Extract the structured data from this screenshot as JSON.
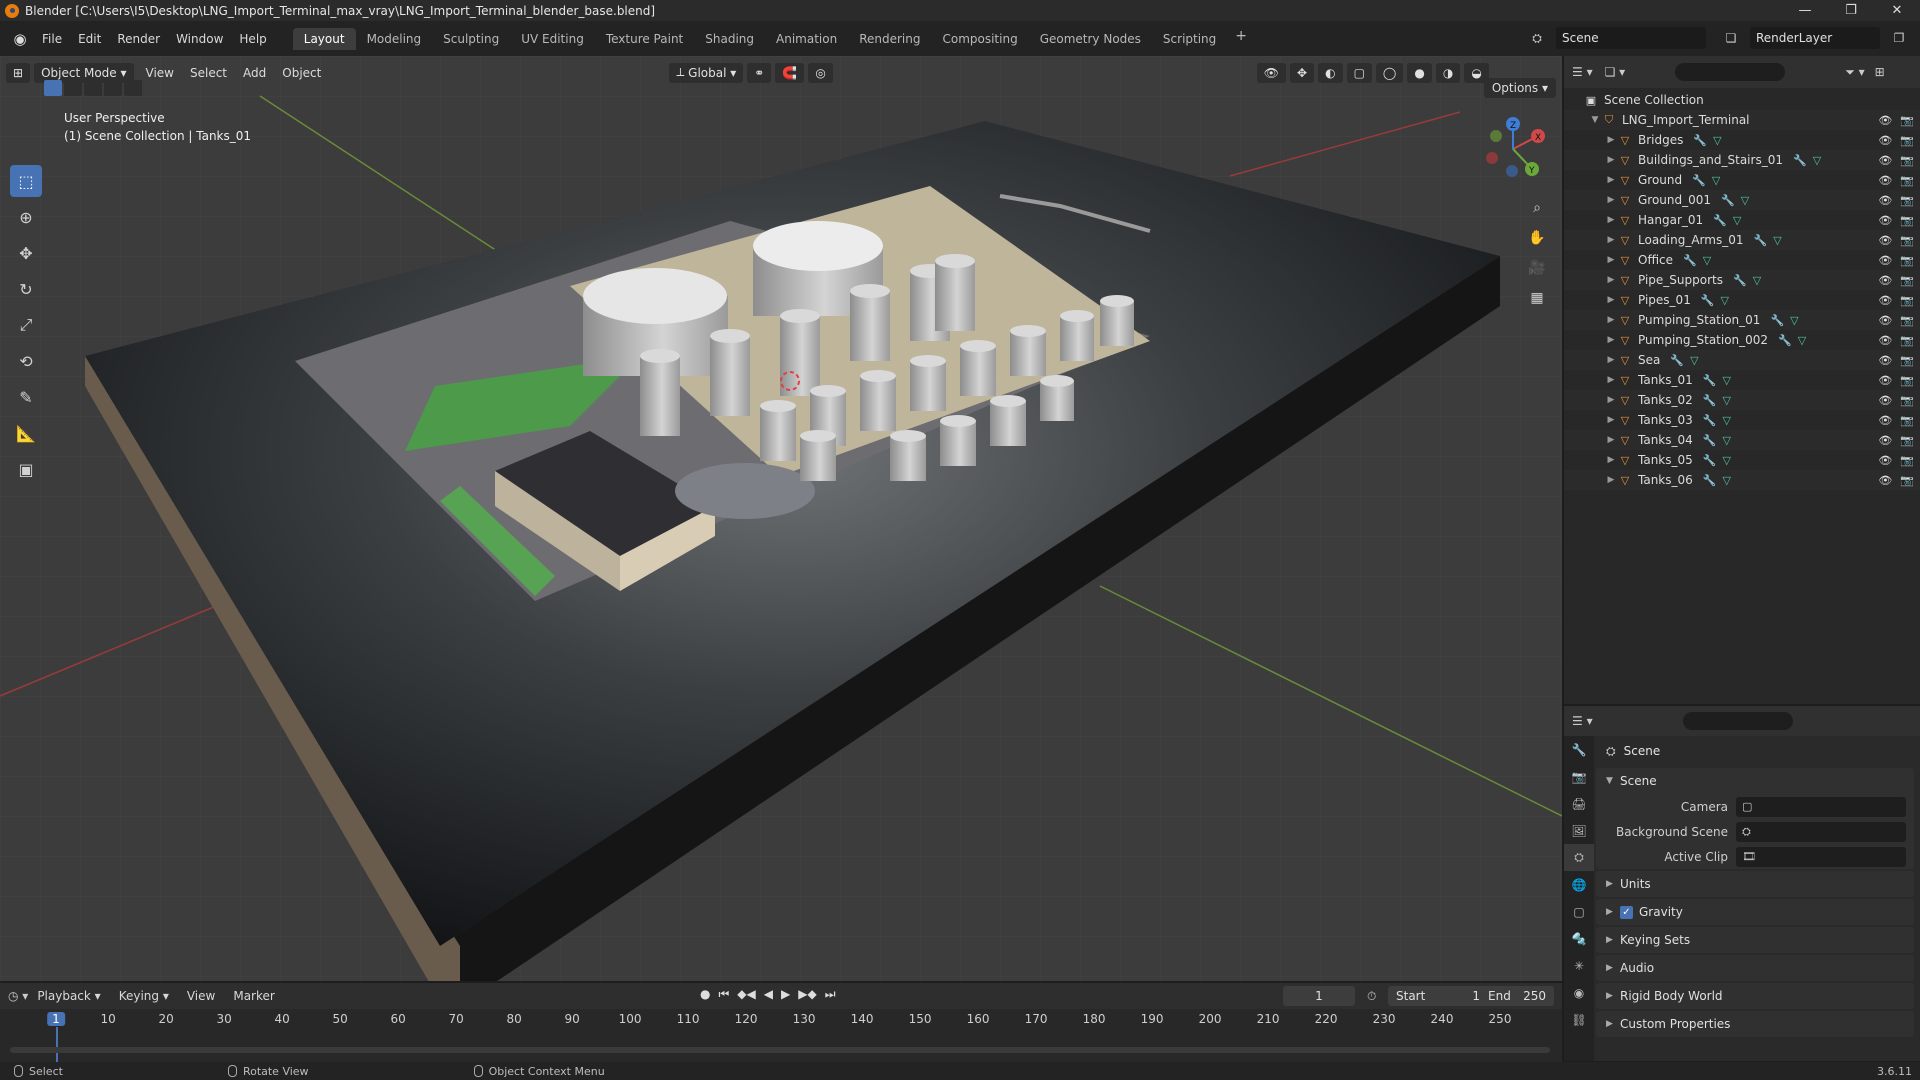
{
  "window": {
    "title": "Blender [C:\\Users\\I5\\Desktop\\LNG_Import_Terminal_max_vray\\LNG_Import_Terminal_blender_base.blend]",
    "minimize": "—",
    "maximize": "❐",
    "close": "✕"
  },
  "menu": [
    "File",
    "Edit",
    "Render",
    "Window",
    "Help"
  ],
  "workspaces": [
    "Layout",
    "Modeling",
    "Sculpting",
    "UV Editing",
    "Texture Paint",
    "Shading",
    "Animation",
    "Rendering",
    "Compositing",
    "Geometry Nodes",
    "Scripting"
  ],
  "active_workspace": "Layout",
  "scene_name": "Scene",
  "view_layer": "RenderLayer",
  "viewport": {
    "mode": "Object Mode",
    "menus": [
      "View",
      "Select",
      "Add",
      "Object"
    ],
    "transform_orientation": "Global",
    "options": "Options",
    "perspective": "User Perspective",
    "context": "(1) Scene Collection | Tanks_01",
    "gizmo_axes": {
      "x": "X",
      "y": "Y",
      "z": "Z"
    }
  },
  "outliner": {
    "root": "Scene Collection",
    "collection": "LNG_Import_Terminal",
    "objects": [
      "Bridges",
      "Buildings_and_Stairs_01",
      "Ground",
      "Ground_001",
      "Hangar_01",
      "Loading_Arms_01",
      "Office",
      "Pipe_Supports",
      "Pipes_01",
      "Pumping_Station_01",
      "Pumping_Station_002",
      "Sea",
      "Tanks_01",
      "Tanks_02",
      "Tanks_03",
      "Tanks_04",
      "Tanks_05",
      "Tanks_06"
    ]
  },
  "properties": {
    "title": "Scene",
    "panel_scene": "Scene",
    "camera_label": "Camera",
    "background_scene_label": "Background Scene",
    "active_clip_label": "Active Clip",
    "collapsed_panels": [
      "Units",
      "Gravity",
      "Keying Sets",
      "Audio",
      "Rigid Body World",
      "Custom Properties"
    ]
  },
  "timeline": {
    "menus": [
      "Playback",
      "Keying",
      "View",
      "Marker"
    ],
    "current_frame": "1",
    "start_label": "Start",
    "start": "1",
    "end_label": "End",
    "end": "250",
    "ticks": [
      "1",
      "10",
      "20",
      "30",
      "40",
      "50",
      "60",
      "70",
      "80",
      "90",
      "100",
      "110",
      "120",
      "130",
      "140",
      "150",
      "160",
      "170",
      "180",
      "190",
      "200",
      "210",
      "220",
      "230",
      "240",
      "250"
    ]
  },
  "status": {
    "select": "Select",
    "rotate": "Rotate View",
    "context_menu": "Object Context Menu",
    "version": "3.6.11"
  }
}
